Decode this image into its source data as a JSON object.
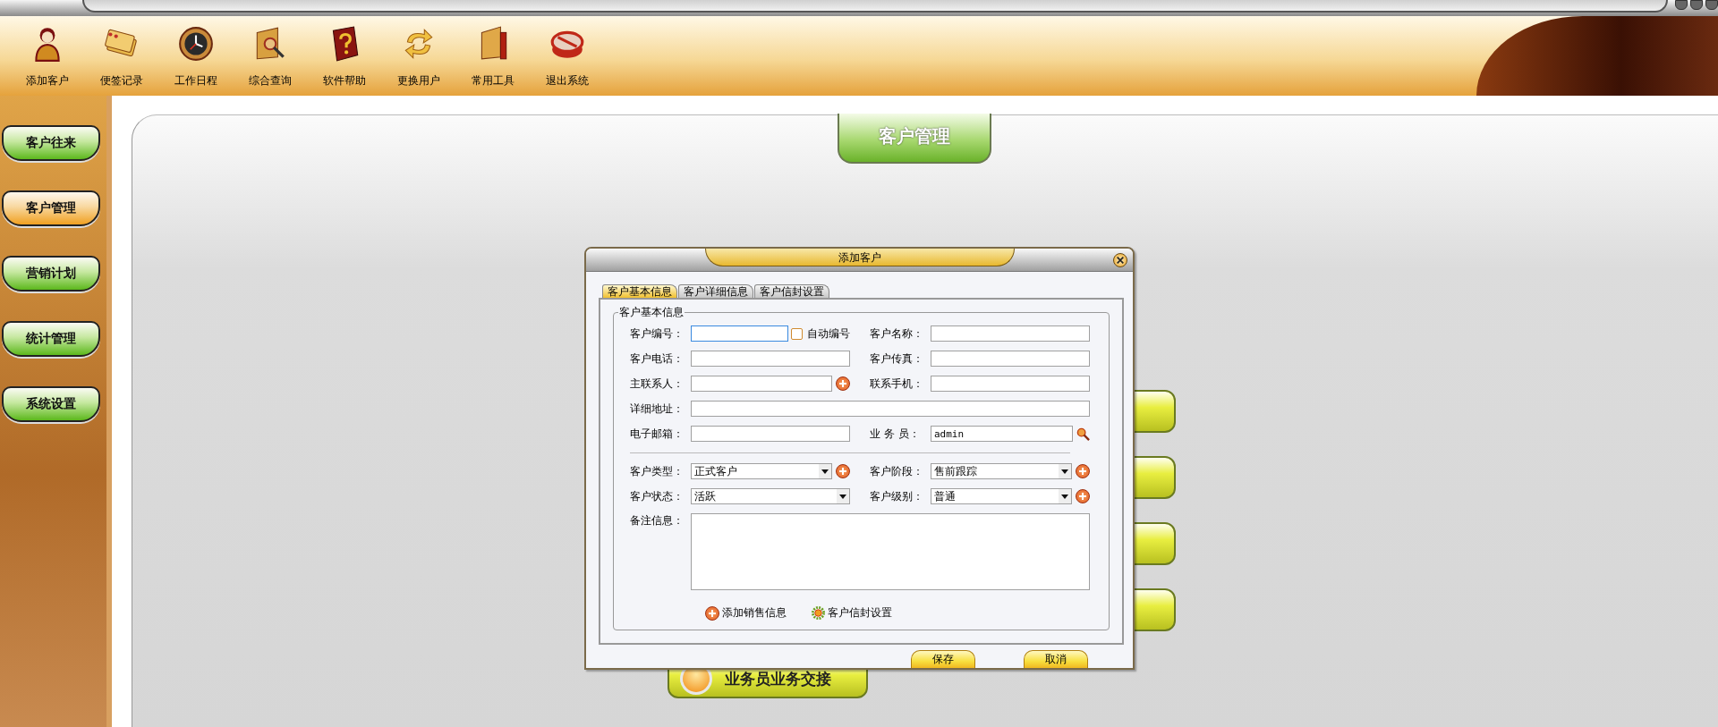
{
  "toolbar": [
    {
      "label": "添加客户",
      "kind": "person"
    },
    {
      "label": "便签记录",
      "kind": "notes"
    },
    {
      "label": "工作日程",
      "kind": "clock"
    },
    {
      "label": "综合查询",
      "kind": "query"
    },
    {
      "label": "软件帮助",
      "kind": "help"
    },
    {
      "label": "更换用户",
      "kind": "switch"
    },
    {
      "label": "常用工具",
      "kind": "tools"
    },
    {
      "label": "退出系统",
      "kind": "exit"
    }
  ],
  "sidebar": {
    "items": [
      {
        "label": "客户往来",
        "selected": false
      },
      {
        "label": "客户管理",
        "selected": true
      },
      {
        "label": "营销计划",
        "selected": false
      },
      {
        "label": "统计管理",
        "selected": false
      },
      {
        "label": "系统设置",
        "selected": false
      }
    ]
  },
  "main": {
    "title": "客户管理",
    "tile": "业务员业务交接"
  },
  "dialog": {
    "title": "添加客户",
    "tabs": [
      {
        "label": "客户基本信息",
        "selected": true
      },
      {
        "label": "客户详细信息",
        "selected": false
      },
      {
        "label": "客户信封设置",
        "selected": false
      }
    ],
    "group_title": "客户基本信息",
    "fields": [
      {
        "label": "客户编号：",
        "kind": "text",
        "focused": true,
        "checkbox": {
          "label": "自动编号",
          "checked": false
        }
      },
      {
        "label": "客户名称：",
        "kind": "text",
        "focused": false
      },
      {
        "label": "客户电话：",
        "kind": "text",
        "focused": false
      },
      {
        "label": "客户传真：",
        "kind": "text",
        "focused": false
      },
      {
        "label": "主联系人：",
        "kind": "text",
        "focused": false,
        "add_button": true
      },
      {
        "label": "联系手机：",
        "kind": "text",
        "focused": false
      },
      {
        "label": "详细地址：",
        "kind": "wide",
        "focused": false
      },
      {
        "label": "电子邮箱：",
        "kind": "text",
        "focused": false
      },
      {
        "label": "业 务 员：",
        "kind": "text",
        "focused": false,
        "value": "admin",
        "search_button": true
      },
      {
        "kind": "divider"
      },
      {
        "label": "客户类型：",
        "kind": "select",
        "focused": false,
        "value": "正式客户",
        "add_button": true
      },
      {
        "label": "客户阶段：",
        "kind": "select",
        "focused": false,
        "value": "售前跟踪",
        "add_button": true
      },
      {
        "label": "客户状态：",
        "kind": "select",
        "focused": false,
        "value": "活跃"
      },
      {
        "label": "客户级别：",
        "kind": "select",
        "focused": false,
        "value": "普通",
        "add_button": true
      },
      {
        "label": "备注信息：",
        "kind": "textarea",
        "focused": false
      }
    ],
    "links": [
      {
        "label": "添加销售信息",
        "kind": "add"
      },
      {
        "label": "客户信封设置",
        "kind": "gear"
      }
    ],
    "buttons": [
      "保存",
      "取消"
    ]
  }
}
